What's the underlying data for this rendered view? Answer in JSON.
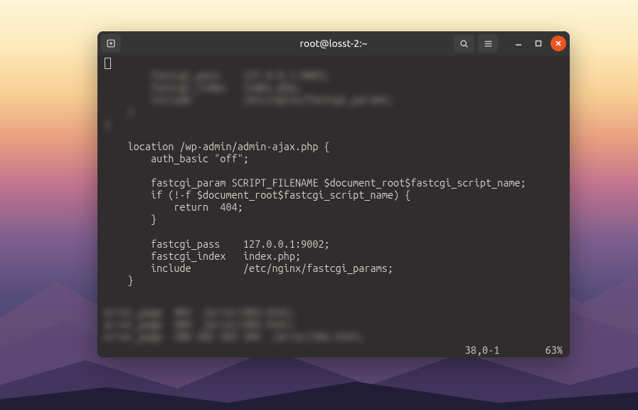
{
  "titlebar": {
    "title": "root@losst-2:~"
  },
  "editor": {
    "blurred_top": "        fastcgi_pass    127.0.0.1:9002;\n        fastcgi_index   index.php;\n        include         /etc/nginx/fastcgi_params;\n    }\n}",
    "config": "    location /wp-admin/admin-ajax.php {\n        auth_basic \"off\";\n\n        fastcgi_param SCRIPT_FILENAME $document_root$fastcgi_script_name;\n        if (!-f $document_root$fastcgi_script_name) {\n            return  404;\n        }\n\n        fastcgi_pass    127.0.0.1:9002;\n        fastcgi_index   index.php;\n        include         /etc/nginx/fastcgi_params;\n    }",
    "blurred_bottom": "error_page  403  /error/403.html;\nerror_page  404  /error/404.html;\nerror_page  500 502 503 504  /error/50x.html;",
    "status_position": "38,0-1",
    "status_percent": "63%"
  },
  "icons": {
    "newtab": "new-tab-icon",
    "search": "search-icon",
    "menu": "hamburger-menu-icon",
    "minimize": "minimize-icon",
    "maximize": "maximize-icon",
    "close": "close-icon"
  }
}
